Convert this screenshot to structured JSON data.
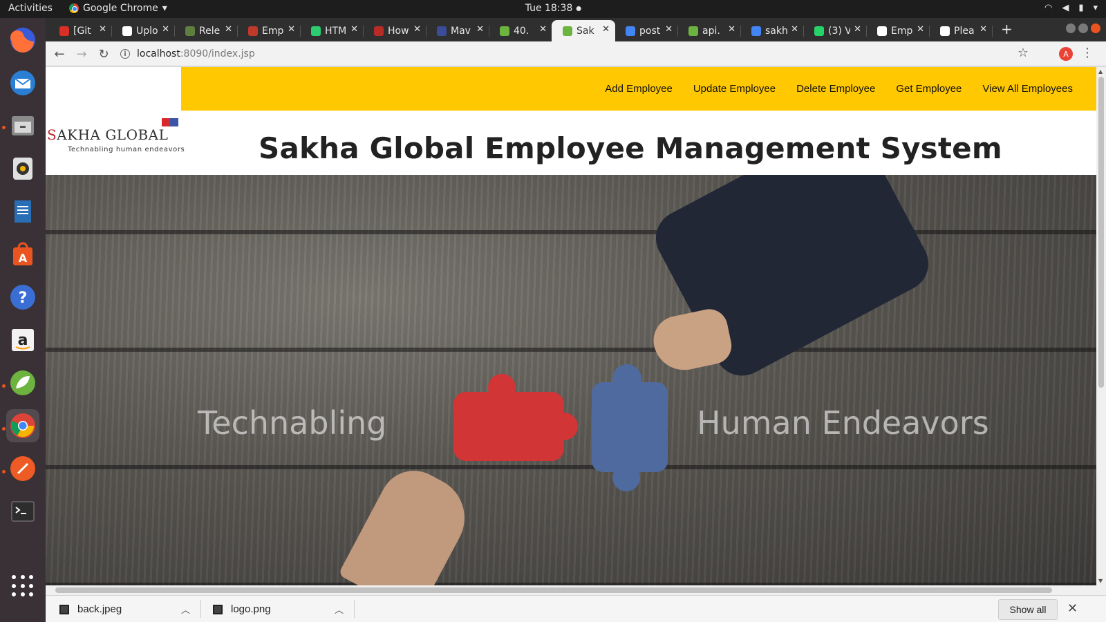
{
  "topbar": {
    "activities": "Activities",
    "app_name": "Google Chrome",
    "clock": "Tue 18:38"
  },
  "dock": {
    "items": [
      "firefox-icon",
      "thunderbird-icon",
      "files-icon",
      "rhythmbox-icon",
      "writer-icon",
      "software-center-icon",
      "help-icon",
      "amazon-icon",
      "spring-tool-suite-icon",
      "chrome-icon",
      "postman-icon",
      "terminal-icon"
    ]
  },
  "tabs": [
    {
      "label": "[Git",
      "color": "#d93025"
    },
    {
      "label": "Uplo",
      "color": "#ffffff"
    },
    {
      "label": "Rele",
      "color": "#5f7f3f"
    },
    {
      "label": "Emp",
      "color": "#c0392b"
    },
    {
      "label": "HTM",
      "color": "#2ecc71"
    },
    {
      "label": "How",
      "color": "#b92b27"
    },
    {
      "label": "Mav",
      "color": "#3b4c9b"
    },
    {
      "label": "40.",
      "color": "#6db33f"
    },
    {
      "label": "Sak",
      "color": "#6db33f"
    },
    {
      "label": "post",
      "color": "#4285f4"
    },
    {
      "label": "api.",
      "color": "#6db33f"
    },
    {
      "label": "sakh",
      "color": "#4285f4"
    },
    {
      "label": "(3) V",
      "color": "#25d366"
    },
    {
      "label": "Emp",
      "color": "#ffffff"
    },
    {
      "label": "Plea",
      "color": "#ffffff"
    }
  ],
  "address_bar": {
    "host": "localhost",
    "path": ":8090/index.jsp",
    "profile_initial": "A"
  },
  "nav": {
    "links": [
      "Add Employee",
      "Update Employee",
      "Delete Employee",
      "Get Employee",
      "View All Employees"
    ],
    "bg_color": "#ffc800"
  },
  "logo": {
    "brand_first": "S",
    "brand_rest": "AKHA GLOBAL",
    "tagline": "Technabling human endeavors"
  },
  "page": {
    "title": "Sakha Global Employee Management System"
  },
  "hero": {
    "left_text": "Technabling",
    "right_text": "Human Endeavors"
  },
  "downloads": {
    "items": [
      "back.jpeg",
      "logo.png"
    ],
    "show_all": "Show all"
  }
}
